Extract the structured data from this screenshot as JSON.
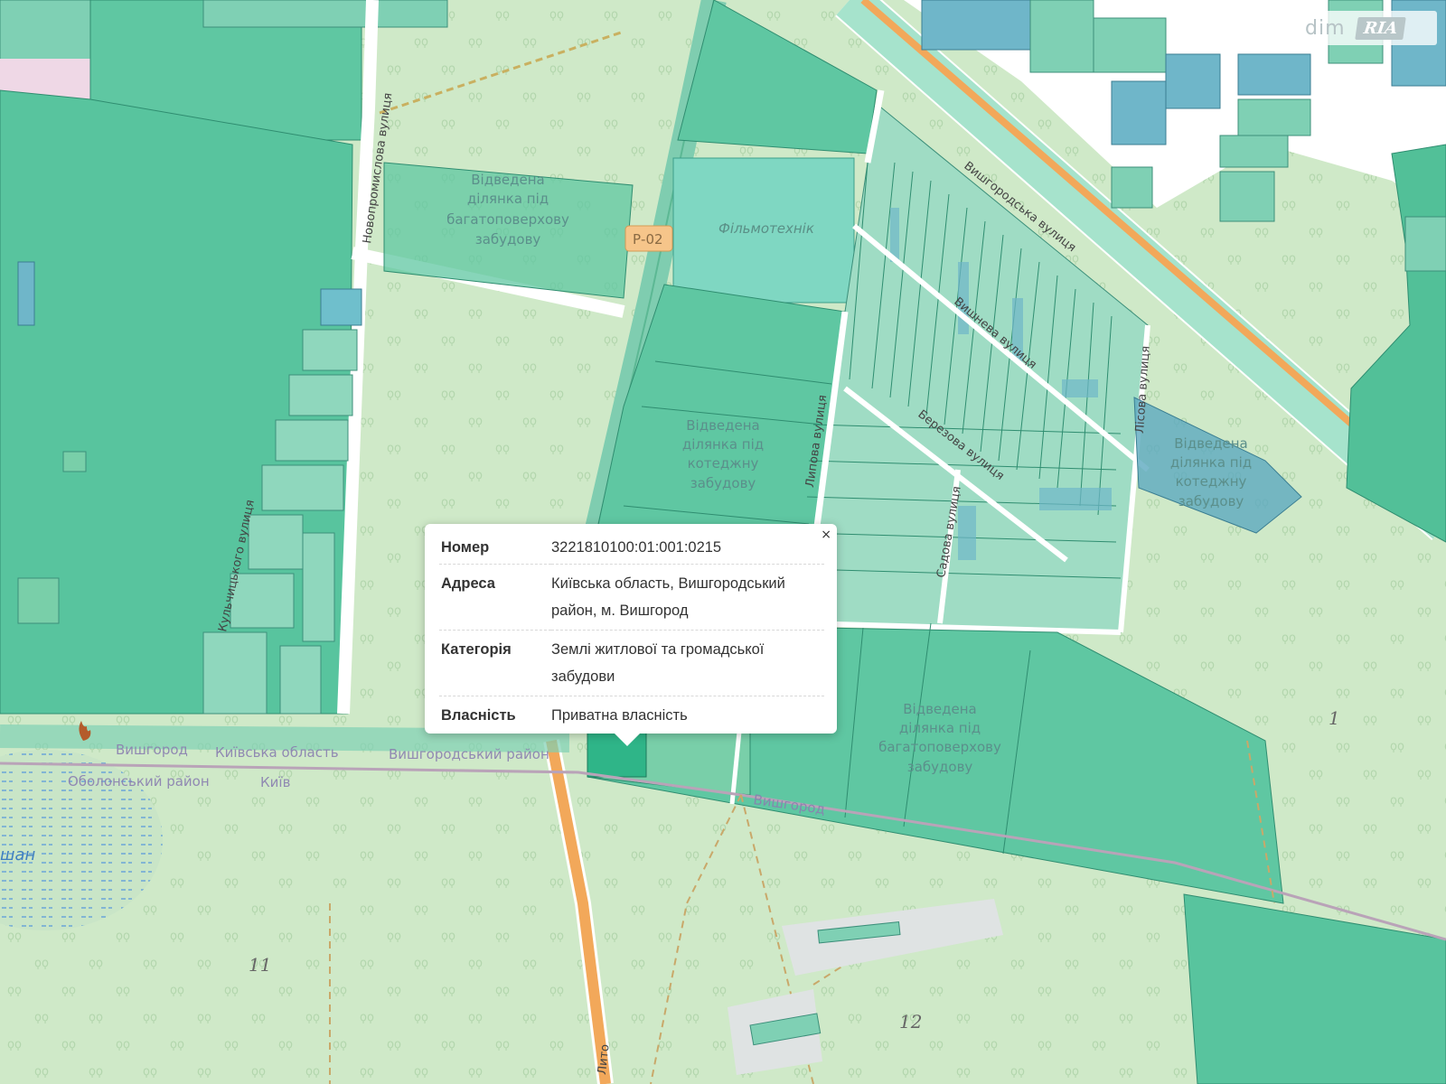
{
  "watermark": {
    "dim": "dim",
    "ria": "RIA"
  },
  "popup": {
    "close_label": "×",
    "rows": [
      {
        "key": "Номер",
        "value": "3221810100:01:001:0215"
      },
      {
        "key": "Адреса",
        "value": "Київська область, Вишгородський район, м. Вишгород"
      },
      {
        "key": "Категорія",
        "value": "Землі житлової та громадської забудови"
      },
      {
        "key": "Власність",
        "value": "Приватна власність"
      }
    ]
  },
  "map": {
    "road_ref": "Р-02",
    "poi": "Фільмотехнік",
    "streets": {
      "vyshhorodska": "Вишгородська вулиця",
      "novopromyslova": "Новопромислова вулиця",
      "kulchytskoho": "Кульчицького вулиця",
      "vyshneva": "Вишнева вулиця",
      "lypova": "Липова вулиця",
      "berezova": "Березова вулиця",
      "sadova": "Садова вулиця",
      "lisova": "Лісова вулиця",
      "lyto": "Лито"
    },
    "zones": {
      "allocated_multistorey_1": [
        "Відведена",
        "ділянка під",
        "багатоповерхову",
        "забудову"
      ],
      "allocated_cottage_1": [
        "Відведена",
        "ділянка під",
        "котеджну",
        "забудову"
      ],
      "allocated_cottage_2": [
        "Відведена",
        "ділянка під",
        "котеджну",
        "забудову"
      ],
      "allocated_multistorey_2": [
        "Відведена",
        "ділянка під",
        "багатоповерхову",
        "забудову"
      ]
    },
    "admin_labels": {
      "vyshhorod_a": "Вишгород",
      "kyiv_oblast": "Київська область",
      "vyshhorod_raion": "Вишгородський район",
      "obolon_raion": "Оболонський район",
      "kyiv": "Київ",
      "vyshhorod_b": "Вишгород",
      "lake": "шан"
    },
    "block_numbers": {
      "n1": "1",
      "n11": "11",
      "n12": "12"
    }
  }
}
